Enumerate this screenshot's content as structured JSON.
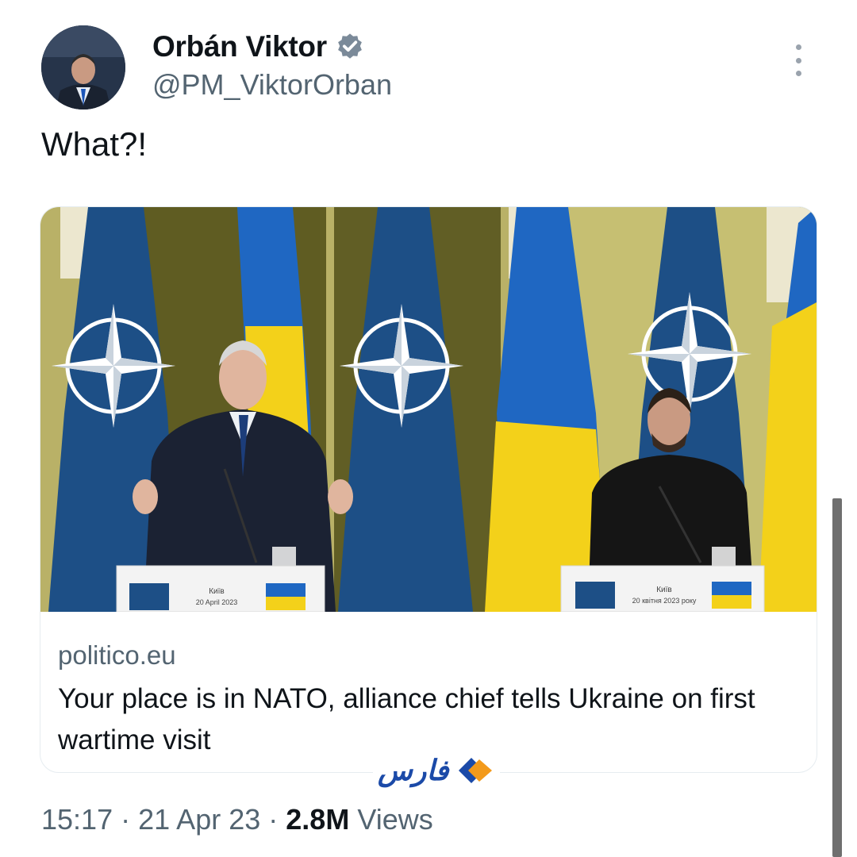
{
  "tweet": {
    "display_name": "Orbán Viktor",
    "handle": "@PM_ViktorOrban",
    "text": "What?!",
    "verified": true
  },
  "card": {
    "domain": "politico.eu",
    "title": "Your place is in NATO, alliance chief tells Ukraine on first wartime visit",
    "podium_left": {
      "line1": "Київ",
      "line2": "20 April 2023"
    },
    "podium_right": {
      "line1": "Київ",
      "line2": "20 квітня 2023 року"
    }
  },
  "watermark": {
    "text": "فارس"
  },
  "meta": {
    "time": "15:17",
    "date": "21 Apr 23",
    "views_count": "2.8M",
    "views_label": "Views",
    "separator": "·"
  },
  "colors": {
    "nato_blue": "#1d4f86",
    "ukraine_blue": "#1f67c2",
    "ukraine_yellow": "#f3d11a",
    "curtain": "#6c6a24",
    "secondary_text": "#536471"
  }
}
